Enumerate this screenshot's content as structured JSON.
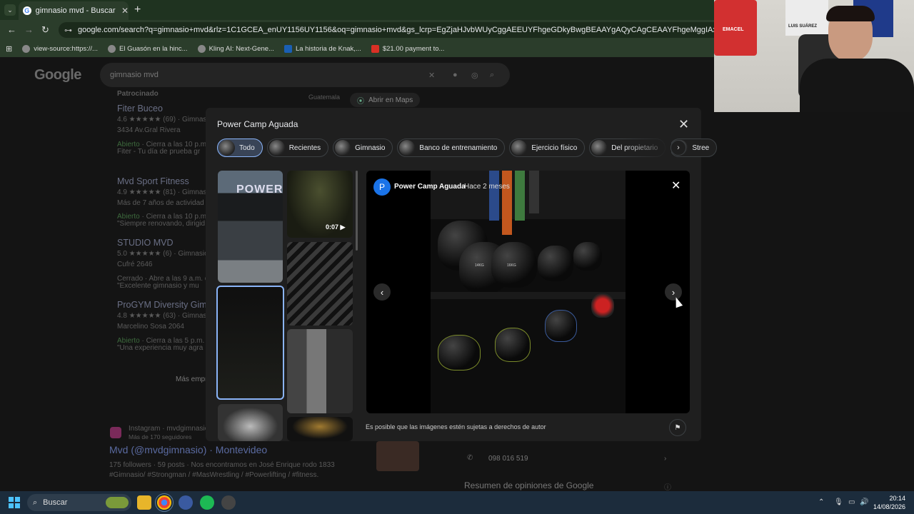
{
  "browser": {
    "tab_title": "gimnasio mvd - Buscar con Goo",
    "url": "google.com/search?q=gimnasio+mvd&rlz=1C1GCEA_enUY1156UY1156&oq=gimnasio+mvd&gs_lcrp=EgZjaHJvbWUyCggAEEUYFhgeGDkyBwgBEAAYgAQyCAgCEAAYFhgeMggIAxAAGBYYHjIICAQQABgWGB4yCAgFEAA",
    "bookmarks": [
      "view-source:https://...",
      "El Guasón en la hinc...",
      "Kling AI: Next-Gene...",
      "La historia de Knak,...",
      "$21.00 payment to..."
    ]
  },
  "google": {
    "logo": "Google",
    "query": "gimnasio mvd",
    "sponsored": "Patrocinado",
    "map_place": "Guatemala",
    "open_maps": "Abrir en Maps",
    "results": [
      {
        "name": "Fiter Buceo",
        "rating": "4.6 ★★★★★ (69) · Gimnas",
        "line2": "3434 Av.Gral Rivera",
        "status": "Abierto",
        "hours": " · Cierra a las 10 p.m.",
        "extra": "Fiter - Tu día de prueba gr"
      },
      {
        "name": "Mvd Sport Fitness",
        "rating": "4.9 ★★★★★ (81) · Gimnas",
        "line2": "Más de 7 años de actividad · ",
        "status": "Abierto",
        "hours": " · Cierra a las 10 p.m. · ",
        "extra": "\"Siempre renovando, dirigid"
      },
      {
        "name": "STUDIO MVD",
        "rating": "5.0 ★★★★★ (6) · Gimnasio",
        "line2": "Cufré 2646",
        "status": "Cerrado",
        "hours": " · Abre a las 9 a.m. de",
        "extra": "\"Excelente gimnasio y mu"
      },
      {
        "name": "ProGYM Diversity Gim...",
        "rating": "4.8 ★★★★★ (63) · Gimnas",
        "line2": "Marcelino Sosa 2064",
        "status": "Abierto",
        "hours": " · Cierra a las 5 p.m. de",
        "extra": "\"Una experiencia muy agra"
      }
    ],
    "more": "Más empr",
    "instagram": {
      "source": "Instagram · mvdgimnasio",
      "followers_note": "Más de 170 seguidores",
      "title": "Mvd (@mvdgimnasio) · Montevideo",
      "snippet": "175 followers · 59 posts · Nos encontramos en José Enrique rodo 1833 #Gimnasio/ #Strongman / #MasWrestling / #Powerlifting / #fitness."
    },
    "phone": "098 016 519",
    "reviews_title": "Resumen de opiniones de Google"
  },
  "modal": {
    "title": "Power Camp Aguada",
    "chips": [
      "Todo",
      "Recientes",
      "Gimnasio",
      "Banco de entrenamiento",
      "Ejercicio físico",
      "Del propietario",
      "Stree"
    ],
    "video_duration": "0:07",
    "thumb_sign": "POWER",
    "viewer": {
      "avatar_letter": "P",
      "author": "Power Camp Aguada",
      "time": "Hace 2 meses",
      "weights": [
        "14KG",
        "16KG"
      ]
    },
    "copyright": "Es posible que las imágenes estén sujetas a derechos de autor"
  },
  "taskbar": {
    "search": "Buscar",
    "time": "20:14",
    "date": "14/08/2026"
  },
  "webcam": {
    "poster": "LUIS SUÁREZ",
    "jersey": "EMACEL"
  }
}
